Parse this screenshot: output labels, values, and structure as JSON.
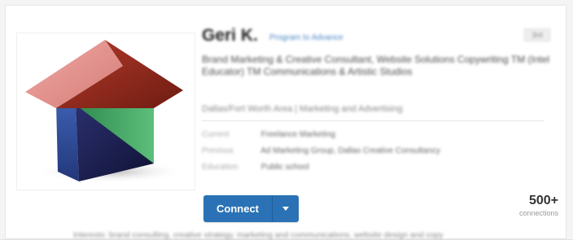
{
  "profile": {
    "name": "Geri K.",
    "name_link": "Program to Advance",
    "badge": "3rd",
    "headline": "Brand Marketing & Creative Consultant, Website Solutions Copywriting TM (Intel Educator) TM Communications & Artistic Studios",
    "location": "Dallas/Fort Worth Area | Marketing and Advertising",
    "details": [
      {
        "label": "Current",
        "value": "Freelance Marketing"
      },
      {
        "label": "Previous",
        "value": "Ad Marketing Group, Dallas Creative Consultancy"
      },
      {
        "label": "Education",
        "value": "Public school"
      }
    ]
  },
  "actions": {
    "connect_label": "Connect"
  },
  "connections": {
    "count": "500+",
    "label": "connections"
  },
  "footer_text": "Interests: brand consulting, creative strategy, marketing and communications, website design and copy",
  "icons": {
    "logo": "house-logo-icon",
    "caret": "caret-down-icon"
  },
  "colors": {
    "connect_button": "#2a72b5",
    "roof_light": "#e08a86",
    "roof_dark": "#8e2a1d",
    "wall_blue": "#2e4a92",
    "wall_green": "#3e9b5c"
  }
}
